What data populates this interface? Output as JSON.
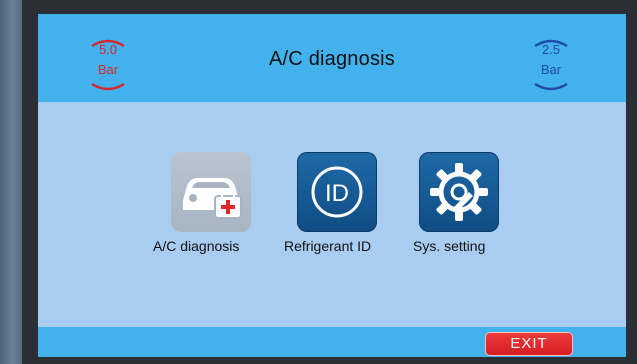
{
  "header": {
    "title": "A/C diagnosis",
    "left_gauge": {
      "value": "5.0",
      "unit": "Bar",
      "color": "#d8262f"
    },
    "right_gauge": {
      "value": "2.5",
      "unit": "Bar",
      "color": "#1f4aa6"
    }
  },
  "menu": {
    "items": [
      {
        "label": "A/C diagnosis",
        "icon": "car-medical-icon"
      },
      {
        "label": "Refrigerant ID",
        "icon": "id-icon"
      },
      {
        "label": "Sys. setting",
        "icon": "gear-wrench-icon"
      }
    ]
  },
  "footer": {
    "exit_label": "EXIT"
  },
  "colors": {
    "header_bg": "#43b1ec",
    "screen_bg": "#a9cdf0",
    "tile_blue": "#0f4c84",
    "exit_red": "#d41d22"
  }
}
